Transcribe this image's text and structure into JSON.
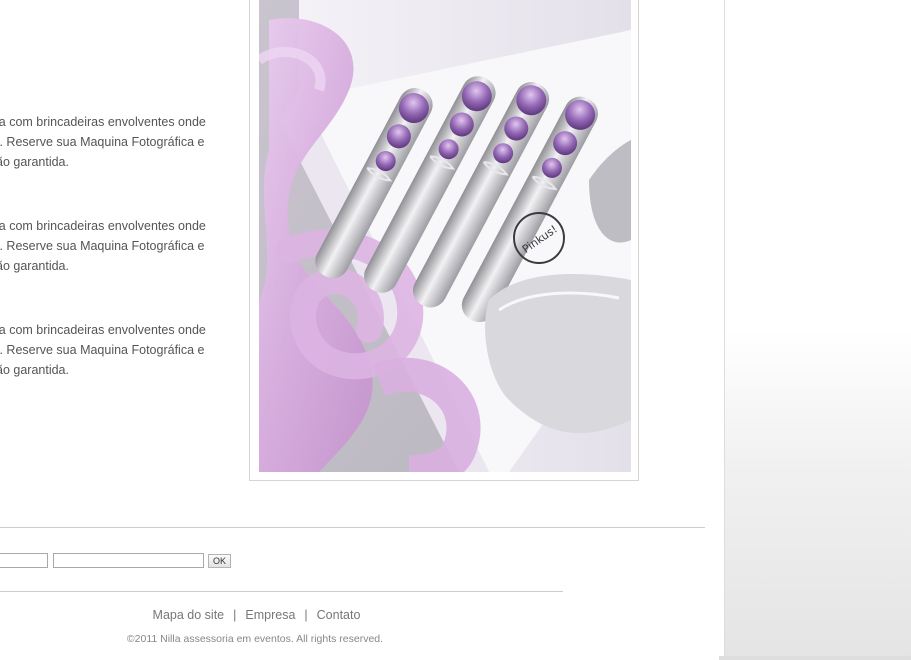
{
  "content": {
    "snippets": [
      {
        "lines": [
          "la com brincadeiras envolventes onde",
          "r. Reserve sua Maquina Fotográfica e",
          "ão garantida."
        ]
      },
      {
        "lines": [
          "la com brincadeiras envolventes onde",
          "r. Reserve sua Maquina Fotográfica e",
          "ão garantida."
        ]
      },
      {
        "lines": [
          "la com brincadeiras envolventes onde",
          "r. Reserve sua Maquina Fotográfica e",
          "ão garantida."
        ]
      }
    ],
    "photo": {
      "engraving": "Pinkus!"
    }
  },
  "form": {
    "field_1_value": "",
    "field_2_value": "",
    "ok_label": "OK"
  },
  "footer": {
    "links": [
      "Mapa do site",
      "Empresa",
      "Contato"
    ],
    "separator": "|",
    "copyright": "©2011 Nilla assessoria em eventos. All rights reserved."
  },
  "colors": {
    "ribbon": "#dcb4e2",
    "gem": "#8a5aa8",
    "text": "#555555"
  }
}
